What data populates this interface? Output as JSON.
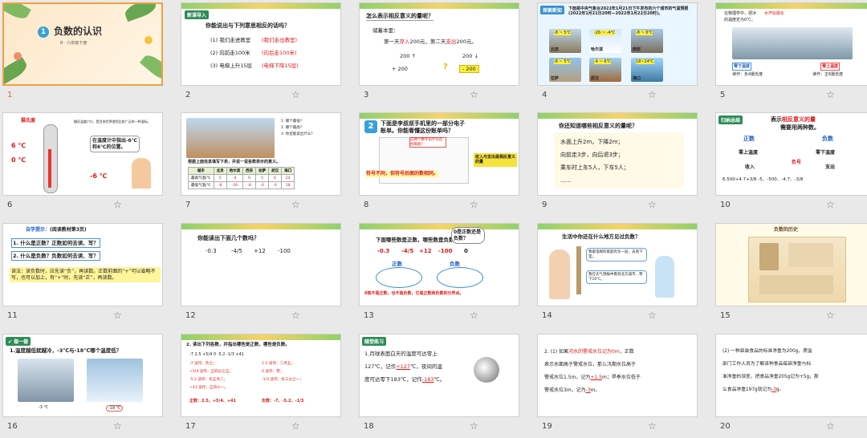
{
  "slides": [
    {
      "num": "1",
      "title": "负数的认识",
      "badge": "1",
      "subtitle": "R · 六年级下册"
    },
    {
      "num": "2",
      "tag": "新课导入",
      "q": "你能说出与下列意思相反的话吗？",
      "items": [
        "(1) 我们走进教室",
        "(2) 向前走100米",
        "(3) 电梯上升15层"
      ],
      "answers": [
        "(我们走出教室)",
        "(向后走100米)",
        "(电梯下降15层)"
      ]
    },
    {
      "num": "3",
      "title": "怎么表示相反意义的量呢？",
      "line1": "储蓄本里：",
      "line2a": "第一天",
      "line2b": "存入",
      "line2c": "200元，第二天",
      "line2d": "支出",
      "line2e": "200元。",
      "m1a": "200 ↑",
      "m1b": "200 ↓",
      "m2a": "+ 200",
      "m2b": "- 200"
    },
    {
      "num": "4",
      "tag": "探索新知",
      "text": "下面是中央气象台2022年1月21日下午发布的六个城市的气温预报(2022年1月21日20时—2022年1月22日20时)。",
      "cities": [
        "北京",
        "哈尔滨",
        "西安",
        "拉萨",
        "武汉",
        "海口"
      ],
      "temps": [
        "-8 ~ 5℃",
        "-26 ~ -4℃",
        "-8 ~ 6℃",
        "-6 ~ 5℃",
        "-4 ~ 6℃",
        "18~24℃"
      ]
    },
    {
      "num": "5",
      "text1": "在物理学中，把冰",
      "text2": "水开始融化",
      "text3": "的温度定为0℃。",
      "l1": "零下温度",
      "l2": "读作：负4摄氏度",
      "r1": "零上温度",
      "r2": "读作：正6摄氏度"
    },
    {
      "num": "6",
      "title": "摄氏度",
      "t1": "6 ℃",
      "t2": "0 ℃",
      "t3": "-6 ℃",
      "bubble": "在温度计中指出-6℃和6℃的位置。",
      "side": "摄氏温度(℃)，是目前世界使用比较广泛的一种温标。"
    },
    {
      "num": "7",
      "caption": "根据上面信息填写下表，并说一说各数表示的意义。",
      "headers": [
        "城市",
        "北京",
        "哈尔滨",
        "西安",
        "拉萨",
        "武汉",
        "海口"
      ],
      "row1": [
        "最高气温/℃",
        "5",
        "-4",
        "6",
        "5",
        "6",
        "24"
      ],
      "row2": [
        "最低气温/℃",
        "-8",
        "-26",
        "-8",
        "-6",
        "-4",
        "18"
      ],
      "qs": [
        "1. 哪个最低？",
        "2. 哪个最高？",
        "3. 你还能说出什么？"
      ]
    },
    {
      "num": "8",
      "badge": "2",
      "q": "下面是李叔叔手机里的一部分电子账单。你能看懂这份账单吗？",
      "callout": "这两个数字前什么区别啊呢？",
      "side": "收入与支出是相反意义的量",
      "bottom": "符号不同，但符号后面的数相同。"
    },
    {
      "num": "9",
      "title": "你还知道哪些相反意义的量呢？",
      "l1": "水面上升2m，下降2m；",
      "l2": "向前走3步，向后退3步；",
      "l3": "乘车时上车5人，下车5人；",
      "l4": "……"
    },
    {
      "num": "10",
      "tag": "归纳总结",
      "head1": "表示",
      "head2": "相反意义的量",
      "head3": "需要用两种数。",
      "c1": "正数",
      "c2": "负数",
      "a1": "零上温度",
      "a2": "零下温度",
      "b1": "收入",
      "b2": "支出",
      "sign": "负号",
      "line": "6.500+4.7+3/8    -5、-500、-4.7、-3/8"
    },
    {
      "num": "11",
      "tag": "自学提示：",
      "tag2": "(阅读教材第3页)",
      "q1": "1. 什么是正数？正数如何去读、写？",
      "q2": "2. 什么是负数？负数如何去读、写？",
      "body": "读法：读负数时，应先读“负”，再读数。正数前面的“+”可以省略不写，也可以加上，有“+”时，先读“正”，再读数。"
    },
    {
      "num": "12",
      "q": "你能读出下面几个数吗？",
      "nums": [
        "-0.3",
        "-4/5",
        "+12",
        "-100"
      ]
    },
    {
      "num": "13",
      "q": "下面哪些数是正数，哪些数是负数？",
      "bubble": "0是正数还是负数？",
      "nums": [
        "-0.3",
        "-4/5",
        "+12",
        "-100",
        "0"
      ],
      "pos": "正数",
      "neg": "负数",
      "bottom": "0既不是正数，也不是负数，它是正数和负数的分界点。"
    },
    {
      "num": "14",
      "q": "生活中你还在什么地方见过负数？",
      "b1": "我家电梯的家庭有负一层，去地下室。",
      "b2": "我在天气预报中看到北方城市…零下10℃。"
    },
    {
      "num": "15",
      "title": "负数的历史"
    },
    {
      "num": "16",
      "tag": "✔ 做一做",
      "q": "1.温度越低就越冷，-3℃与-18℃哪个温度低？",
      "p1": "-3 ℃",
      "p2": "-18 ℃"
    },
    {
      "num": "17",
      "q": "2. 读出下列各数，并指出哪些是正数，哪些是负数。",
      "row": "-7   2.5   +5/4   0   -5.2   -1/3   +41",
      "lines": [
        "-7 读作：负七；",
        "2.5 读作：二点五；",
        "+5/4 读作：正四分之五；",
        "0 读作：零；",
        "-5.2 读作：负五点二；",
        "-1/3 读作：负三分之一；",
        "+41 读作：正四十一。"
      ],
      "pos": "正数：2.5、+5/4、+41",
      "neg": "负数：-7、-5.2、-1/3"
    },
    {
      "num": "18",
      "tag": "随堂练习",
      "t1": "1.月球表面白天的温度可达零上",
      "t2": "127℃，记作",
      "v1": "+127",
      "t3": "℃，夜间的温",
      "t4": "度可达零下183℃，记作",
      "v2": "-183",
      "t5": "℃。"
    },
    {
      "num": "19",
      "t1": "2. (1) 如果",
      "red": "河水的警戒水位记为0m",
      "t2": "，正数",
      "t3": "表示水面高于警戒水位，那么汛期水位高于",
      "t4": "警戒水位1.5m，记为",
      "v1": "+1.5",
      "t5": "m；旱季水位低于",
      "t6": "警戒水位3m，记为",
      "v2": "-3",
      "t7": "m。"
    },
    {
      "num": "20",
      "t1": "(2) 一种袋装食品的标准净重为200g，质监",
      "t2": "部门工作人员为了解该种食品每袋净重与标",
      "t3": "准净重的误差，把食品净重205g记为+5g，那",
      "t4": "么食品净重197g就记为",
      "v1": "-3",
      "t5": "g。"
    }
  ],
  "ui": {
    "star": "☆",
    "selected_index": 1
  }
}
